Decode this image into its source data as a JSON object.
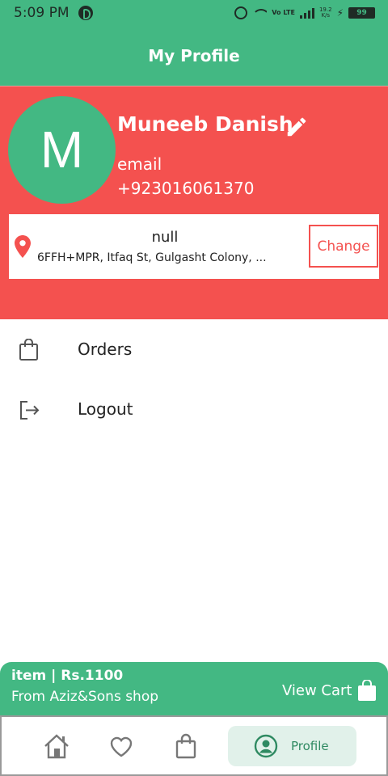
{
  "status_bar": {
    "time": "5:09 PM",
    "volte": "Vo LTE",
    "speed_value": "19.2",
    "speed_unit": "K/s",
    "battery": "99"
  },
  "appbar": {
    "title": "My Profile"
  },
  "profile": {
    "initial": "M",
    "name": "Muneeb Danish",
    "email": "email",
    "phone": "+923016061370"
  },
  "address": {
    "title": "null",
    "line": "6FFH+MPR, Itfaq St, Gulgasht Colony, ...",
    "change_label": "Change"
  },
  "menu": {
    "items": [
      {
        "label": "Orders",
        "icon": "shopping-bag-icon"
      },
      {
        "label": "Logout",
        "icon": "logout-icon"
      }
    ]
  },
  "cart_bar": {
    "price_text": "item | Rs.1100",
    "shop_text": "From Aziz&Sons shop",
    "view_cart_label": "View Cart"
  },
  "bottom_nav": {
    "items": [
      {
        "icon": "home-icon"
      },
      {
        "icon": "heart-icon"
      },
      {
        "icon": "shopping-bag-icon"
      },
      {
        "icon": "profile-icon",
        "label": "Profile",
        "active": true
      }
    ]
  },
  "colors": {
    "primary_green": "#43b883",
    "header_red": "#f4514f",
    "active_nav_bg": "#e1f1ea"
  }
}
